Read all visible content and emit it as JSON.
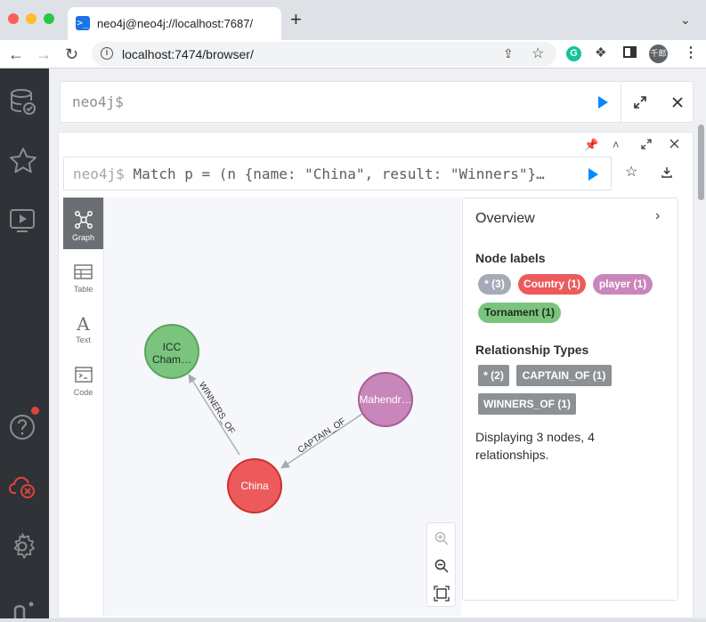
{
  "browser": {
    "tab_title": "neo4j@neo4j://localhost:7687/",
    "new_tab": "+",
    "url": "localhost:7474/browser/",
    "avatar_text": "千郎"
  },
  "editor": {
    "prompt": "neo4j$"
  },
  "frame": {
    "query_prompt": "neo4j$",
    "query": "Match p = (n {name: \"China\", result: \"Winners\"}…"
  },
  "view_tabs": [
    {
      "label": "Graph",
      "icon": "graph-icon"
    },
    {
      "label": "Table",
      "icon": "table-icon"
    },
    {
      "label": "Text",
      "icon": "text-icon",
      "glyph": "A"
    },
    {
      "label": "Code",
      "icon": "code-icon"
    }
  ],
  "graph": {
    "nodes": [
      {
        "label": "ICC Cham…",
        "line1": "ICC",
        "line2": "Cham…",
        "type": "Tornament",
        "color": "#7ac47e",
        "stroke": "#57a55c"
      },
      {
        "label": "Mahendr…",
        "type": "player",
        "color": "#c986bb",
        "stroke": "#a45e96"
      },
      {
        "label": "China",
        "type": "Country",
        "color": "#ec5a5b",
        "stroke": "#cf2f31"
      }
    ],
    "relationships": [
      {
        "type": "WINNERS_OF",
        "from": "China",
        "to": "ICC Cham…"
      },
      {
        "type": "CAPTAIN_OF",
        "from": "Mahendr…",
        "to": "China"
      }
    ]
  },
  "overview": {
    "title": "Overview",
    "node_labels_title": "Node labels",
    "node_labels": [
      {
        "text": "* (3)",
        "bg": "#a5abb6",
        "fg": "#ffffff"
      },
      {
        "text": "Country (1)",
        "bg": "#ec5a5b",
        "fg": "#ffffff"
      },
      {
        "text": "player (1)",
        "bg": "#c986bb",
        "fg": "#ffffff"
      },
      {
        "text": "Tornament (1)",
        "bg": "#7ac47e",
        "fg": "#1e2a1f"
      }
    ],
    "rel_types_title": "Relationship Types",
    "rel_types": [
      "* (2)",
      "CAPTAIN_OF (1)",
      "WINNERS_OF (1)"
    ],
    "summary": "Displaying 3 nodes, 4 relationships."
  },
  "colors": {
    "accent": "#018bff",
    "sidebar_bg": "#2f3236",
    "alert": "#e0433d"
  }
}
